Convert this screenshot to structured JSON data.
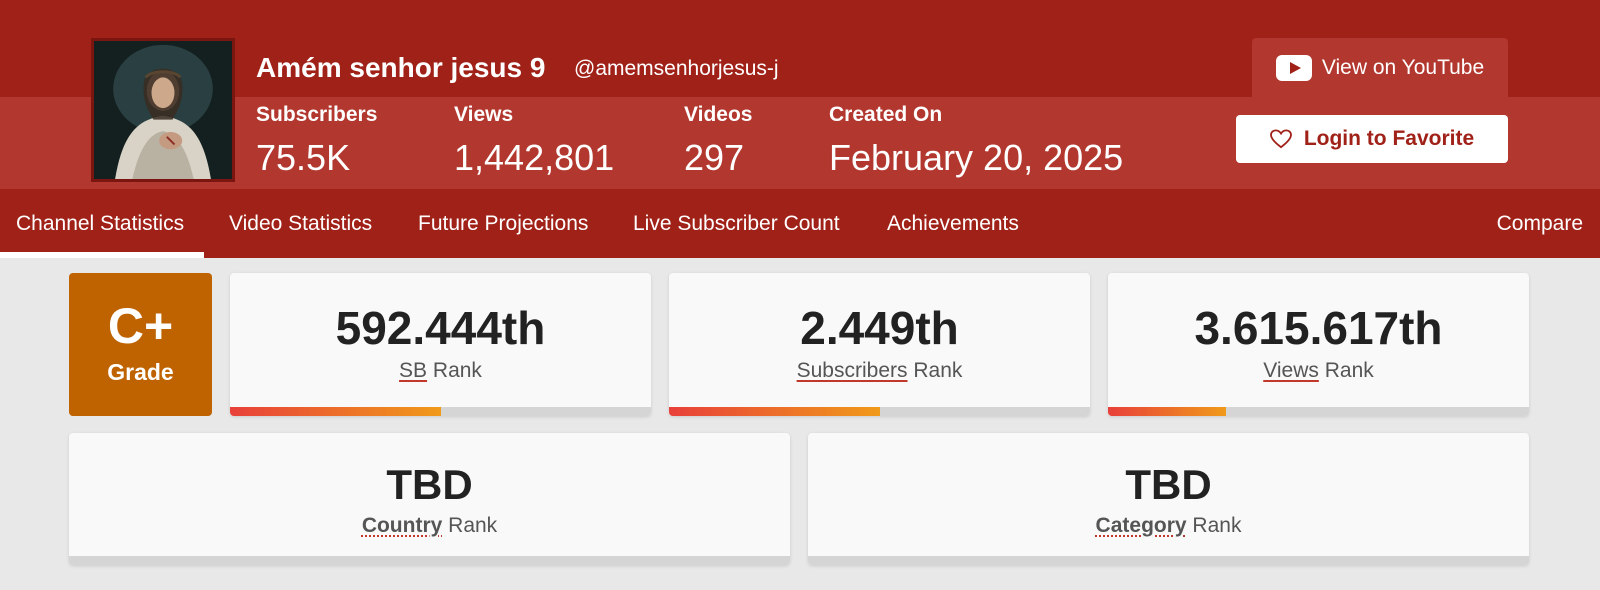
{
  "channel": {
    "name": "Amém senhor jesus 9",
    "handle": "@amemsenhorjesus-j",
    "stats": [
      {
        "label": "Subscribers",
        "value": "75.5K"
      },
      {
        "label": "Views",
        "value": "1,442,801"
      },
      {
        "label": "Videos",
        "value": "297"
      },
      {
        "label": "Created On",
        "value": "February 20, 2025"
      }
    ],
    "youtube_button": "View on YouTube",
    "favorite_button": "Login to Favorite"
  },
  "nav": {
    "items": [
      "Channel Statistics",
      "Video Statistics",
      "Future Projections",
      "Live Subscriber Count",
      "Achievements"
    ],
    "compare": "Compare",
    "active": "Channel Statistics"
  },
  "grade": {
    "letter": "C+",
    "label": "Grade"
  },
  "ranks": [
    {
      "value": "592.444th",
      "link": "SB",
      "suffix": "Rank",
      "progress": 0.5
    },
    {
      "value": "2.449th",
      "link": "Subscribers",
      "suffix": "Rank",
      "progress": 0.5
    },
    {
      "value": "3.615.617th",
      "link": "Views",
      "suffix": "Rank",
      "progress": 0.28
    }
  ],
  "secondary_ranks": [
    {
      "value": "TBD",
      "link": "Country",
      "suffix": "Rank"
    },
    {
      "value": "TBD",
      "link": "Category",
      "suffix": "Rank"
    }
  ],
  "colors": {
    "header_dark": "#a02118",
    "header_light": "#b2372e",
    "grade_bg": "#bf6200",
    "bar_start": "#e8403a",
    "bar_end": "#f09a1a"
  },
  "icons": [
    "youtube-icon",
    "heart-icon"
  ]
}
